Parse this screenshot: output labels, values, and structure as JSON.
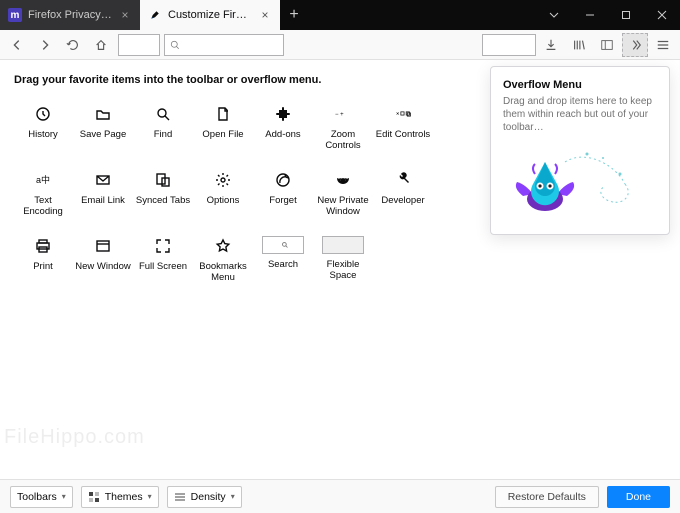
{
  "tabs": [
    {
      "label": "Firefox Privacy Notice — Mozi",
      "favicon": "m"
    },
    {
      "label": "Customize Firefox"
    }
  ],
  "instruction": "Drag your favorite items into the toolbar or overflow menu.",
  "items": [
    {
      "id": "history",
      "label": "History"
    },
    {
      "id": "save-page",
      "label": "Save Page"
    },
    {
      "id": "find",
      "label": "Find"
    },
    {
      "id": "open-file",
      "label": "Open File"
    },
    {
      "id": "addons",
      "label": "Add-ons"
    },
    {
      "id": "zoom",
      "label": "Zoom Controls"
    },
    {
      "id": "edit",
      "label": "Edit Controls"
    },
    {
      "id": "text-encoding",
      "label": "Text Encoding"
    },
    {
      "id": "email-link",
      "label": "Email Link"
    },
    {
      "id": "synced-tabs",
      "label": "Synced Tabs"
    },
    {
      "id": "options",
      "label": "Options"
    },
    {
      "id": "forget",
      "label": "Forget"
    },
    {
      "id": "new-private",
      "label": "New Private Window"
    },
    {
      "id": "developer",
      "label": "Developer"
    },
    {
      "id": "print",
      "label": "Print"
    },
    {
      "id": "new-window",
      "label": "New Window"
    },
    {
      "id": "full-screen",
      "label": "Full Screen"
    },
    {
      "id": "bookmarks-menu",
      "label": "Bookmarks Menu"
    },
    {
      "id": "search",
      "label": "Search"
    },
    {
      "id": "flexible-space",
      "label": "Flexible Space"
    }
  ],
  "overflow": {
    "title": "Overflow Menu",
    "desc": "Drag and drop items here to keep them within reach but out of your toolbar…"
  },
  "bottombar": {
    "toolbars": "Toolbars",
    "themes": "Themes",
    "density": "Density",
    "restore": "Restore Defaults",
    "done": "Done"
  },
  "watermark": "FileHippo.com"
}
